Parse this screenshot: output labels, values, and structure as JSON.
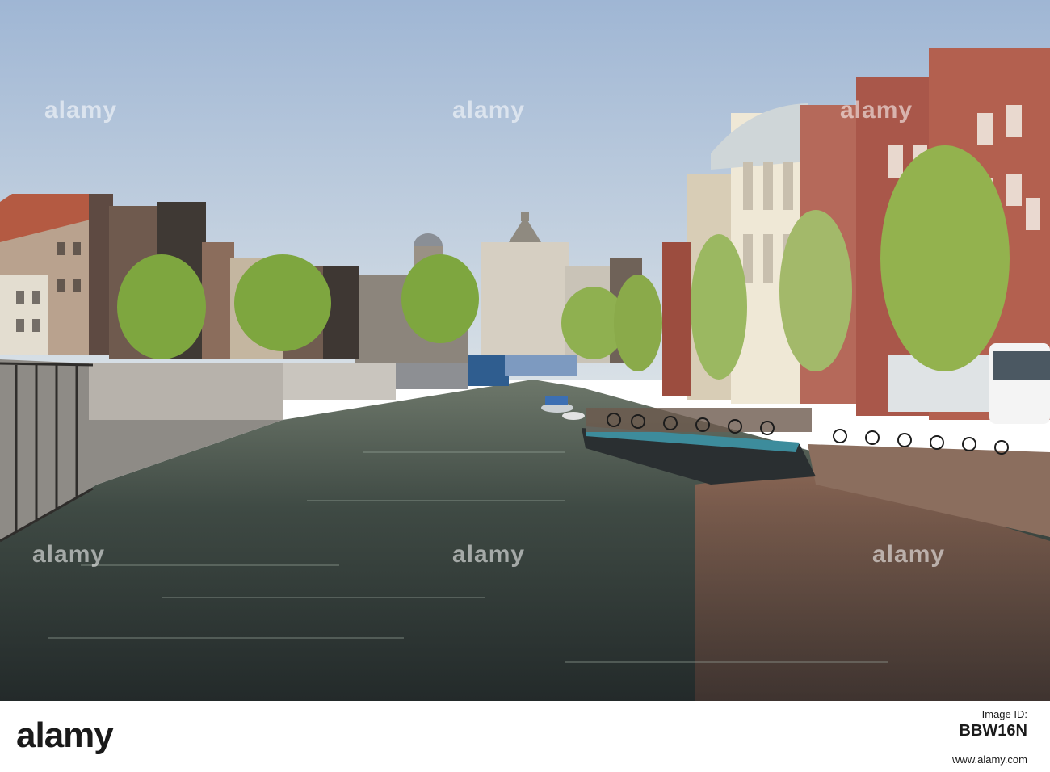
{
  "watermark": {
    "text": "alamy"
  },
  "footer": {
    "brand": "alamy",
    "image_id_label": "Image ID:",
    "image_id": "BBW16N",
    "site": "www.alamy.com"
  },
  "colors": {
    "sky_top": "#9fb6d4",
    "sky_bottom": "#d8e0e6",
    "water": "#3f4a44",
    "brick": "#a9574a"
  }
}
